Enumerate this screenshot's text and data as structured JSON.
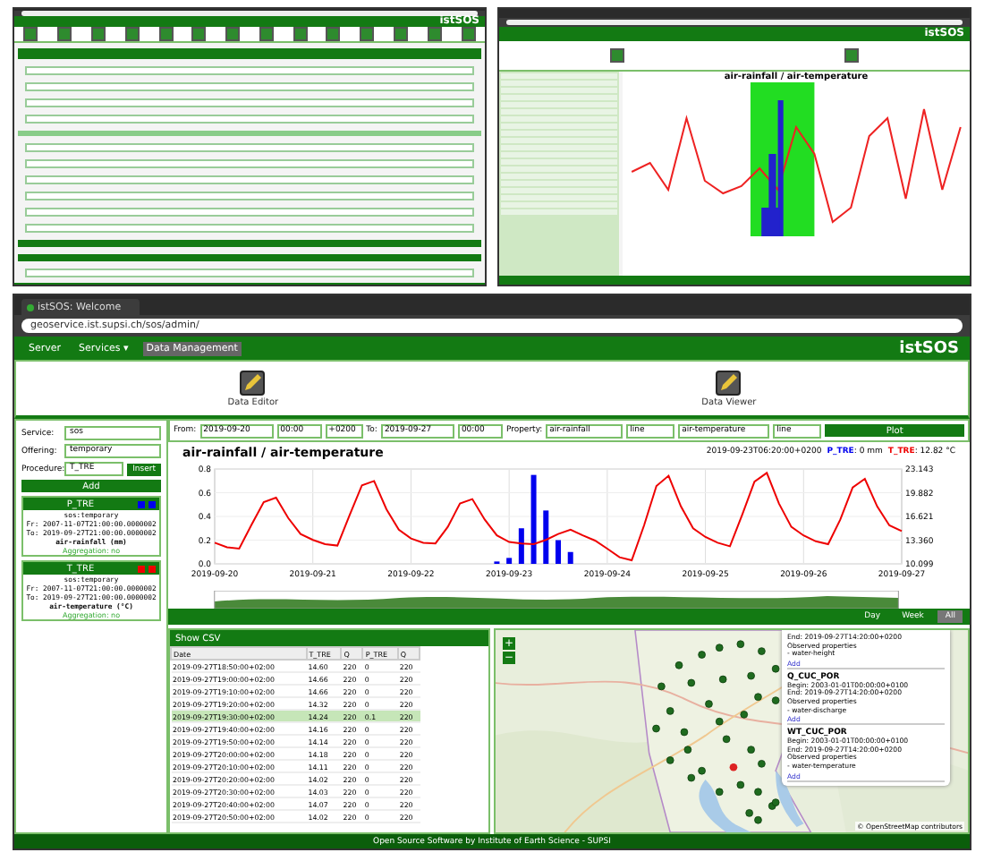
{
  "top_left_window": {
    "logo": "istSOS"
  },
  "top_right_window": {
    "logo": "istSOS",
    "chart_title": "air-rainfall / air-temperature"
  },
  "browser": {
    "tab_title": "istSOS: Welcome",
    "address": "geoservice.ist.supsi.ch/sos/admin/"
  },
  "nav": {
    "items": [
      {
        "label": "Server",
        "selected": false
      },
      {
        "label": "Services ▾",
        "selected": false
      },
      {
        "label": "Data Management",
        "selected": true
      }
    ],
    "logo": "istSOS"
  },
  "tools": [
    {
      "label": "Data Editor"
    },
    {
      "label": "Data Viewer"
    }
  ],
  "sidebar": {
    "fields": [
      {
        "label": "Service:",
        "value": "sos"
      },
      {
        "label": "Offering:",
        "value": "temporary"
      },
      {
        "label": "Procedure:",
        "value": "T_TRE"
      }
    ],
    "insert_button": "Insert",
    "add_button": "Add",
    "procedures": [
      {
        "name": "P_TRE",
        "color": "#0000ee",
        "offering": "sos:temporary",
        "from": "Fr: 2007-11-07T21:00:00.0000002",
        "to": "To: 2019-09-27T21:00:00.0000002",
        "property": "air-rainfall (mm)",
        "aggregation": "Aggregation: no"
      },
      {
        "name": "T_TRE",
        "color": "#ee0000",
        "offering": "sos:temporary",
        "from": "Fr: 2007-11-07T21:00:00.0000002",
        "to": "To: 2019-09-27T21:00:00.0000002",
        "property": "air-temperature (°C)",
        "aggregation": "Aggregation: no"
      }
    ]
  },
  "controls": {
    "from_label": "From:",
    "from_date": "2019-09-20",
    "from_time": "00:00",
    "offset": "+0200",
    "to_label": "To:",
    "to_date": "2019-09-27",
    "to_time": "00:00",
    "property_label": "Property:",
    "property_1": "air-rainfall",
    "style_1": "line",
    "property_2": "air-temperature",
    "style_2": "line",
    "plot_button": "Plot"
  },
  "chart": {
    "legend": {
      "time": "2019-09-23T06:20:00+0200",
      "readings": [
        ": 0 mm",
        ": 12.82 °C"
      ]
    },
    "chart_data": {
      "type": "line",
      "title": "air-rainfall / air-temperature",
      "grid": true,
      "ylim": [
        0,
        0.8
      ],
      "categories": [
        "2019-09-20",
        null,
        null,
        null,
        null,
        null,
        null,
        null,
        "2019-09-21",
        null,
        null,
        null,
        null,
        null,
        null,
        null,
        "2019-09-22",
        null,
        null,
        null,
        null,
        null,
        null,
        null,
        "2019-09-23",
        null,
        null,
        null,
        null,
        null,
        null,
        null,
        "2019-09-24",
        null,
        null,
        null,
        null,
        null,
        null,
        null,
        "2019-09-25",
        null,
        null,
        null,
        null,
        null,
        null,
        null,
        "2019-09-26",
        null,
        null,
        null,
        null,
        null,
        null,
        null,
        "2019-09-27"
      ],
      "yticks": [
        {
          "value": 0,
          "label": "0.0"
        },
        {
          "value": 0.2,
          "label": "0.2"
        },
        {
          "value": 0.4,
          "label": "0.4"
        },
        {
          "value": 0.6,
          "label": "0.6"
        },
        {
          "value": 0.8,
          "label": "0.8"
        }
      ],
      "y2lim": [
        10.099,
        23.143
      ],
      "y2ticks": [
        {
          "value": 10.099,
          "label": "10.099"
        },
        {
          "value": 13.36,
          "label": "13.360"
        },
        {
          "value": 16.621,
          "label": "16.621"
        },
        {
          "value": 19.882,
          "label": "19.882"
        },
        {
          "value": 23.143,
          "label": "23.143"
        }
      ],
      "series": [
        {
          "name": "P_TRE",
          "type": "bar",
          "color": "#0000ee",
          "values": [
            0,
            0,
            0,
            0,
            0,
            0,
            0,
            0,
            0,
            0,
            0,
            0,
            0,
            0,
            0,
            0,
            0,
            0,
            0,
            0,
            0,
            0,
            0,
            0.02,
            0.05,
            0.3,
            0.75,
            0.45,
            0.2,
            0.1,
            0,
            0,
            0,
            0,
            0,
            0,
            0,
            0,
            0,
            0,
            0,
            0,
            0,
            0,
            0,
            0,
            0,
            0,
            0,
            0,
            0,
            0,
            0,
            0,
            0,
            0,
            0
          ]
        },
        {
          "name": "T_TRE",
          "type": "line",
          "axis": "y2",
          "color": "#ee0000",
          "values": [
            13.0,
            12.4,
            12.2,
            15.5,
            18.6,
            19.2,
            16.4,
            14.2,
            13.4,
            12.8,
            12.6,
            16.8,
            20.9,
            21.5,
            17.6,
            14.8,
            13.6,
            13.0,
            12.9,
            15.2,
            18.4,
            19.0,
            16.2,
            14.0,
            13.1,
            12.9,
            12.8,
            13.4,
            14.2,
            14.8,
            14.0,
            13.3,
            12.2,
            11.0,
            10.6,
            15.4,
            20.8,
            22.2,
            18.0,
            15.0,
            13.8,
            13.0,
            12.5,
            16.9,
            21.4,
            22.6,
            18.4,
            15.2,
            14.0,
            13.2,
            12.8,
            16.2,
            20.6,
            21.8,
            18.0,
            15.4,
            14.6
          ]
        }
      ]
    }
  },
  "range_buttons": [
    {
      "label": "Day",
      "selected": false
    },
    {
      "label": "Week",
      "selected": false
    },
    {
      "label": "All",
      "selected": true
    }
  ],
  "table": {
    "title": "Show CSV",
    "columns": [
      "Date",
      "T_TRE",
      "Q",
      "P_TRE",
      "Q"
    ],
    "rows": [
      {
        "cells": [
          "2019-09-27T18:50:00+02:00",
          "14.60",
          "220",
          "0",
          "220"
        ],
        "selected": false
      },
      {
        "cells": [
          "2019-09-27T19:00:00+02:00",
          "14.66",
          "220",
          "0",
          "220"
        ],
        "selected": false
      },
      {
        "cells": [
          "2019-09-27T19:10:00+02:00",
          "14.66",
          "220",
          "0",
          "220"
        ],
        "selected": false
      },
      {
        "cells": [
          "2019-09-27T19:20:00+02:00",
          "14.32",
          "220",
          "0",
          "220"
        ],
        "selected": false
      },
      {
        "cells": [
          "2019-09-27T19:30:00+02:00",
          "14.24",
          "220",
          "0.1",
          "220"
        ],
        "selected": true
      },
      {
        "cells": [
          "2019-09-27T19:40:00+02:00",
          "14.16",
          "220",
          "0",
          "220"
        ],
        "selected": false
      },
      {
        "cells": [
          "2019-09-27T19:50:00+02:00",
          "14.14",
          "220",
          "0",
          "220"
        ],
        "selected": false
      },
      {
        "cells": [
          "2019-09-27T20:00:00+02:00",
          "14.18",
          "220",
          "0",
          "220"
        ],
        "selected": false
      },
      {
        "cells": [
          "2019-09-27T20:10:00+02:00",
          "14.11",
          "220",
          "0",
          "220"
        ],
        "selected": false
      },
      {
        "cells": [
          "2019-09-27T20:20:00+02:00",
          "14.02",
          "220",
          "0",
          "220"
        ],
        "selected": false
      },
      {
        "cells": [
          "2019-09-27T20:30:00+02:00",
          "14.03",
          "220",
          "0",
          "220"
        ],
        "selected": false
      },
      {
        "cells": [
          "2019-09-27T20:40:00+02:00",
          "14.07",
          "220",
          "0",
          "220"
        ],
        "selected": false
      },
      {
        "cells": [
          "2019-09-27T20:50:00+02:00",
          "14.02",
          "220",
          "0",
          "220"
        ],
        "selected": false
      }
    ]
  },
  "map": {
    "kind": "picture",
    "zoom_in": "+",
    "zoom_out": "−",
    "attribution": "© OpenStreetMap contributors",
    "popup": [
      {
        "lines": [
          "End: 2019-09-27T14:20:00+0200",
          "Observed properties",
          "- water-height"
        ],
        "link": "Add"
      },
      {
        "name": "Q_CUC_POR",
        "lines": [
          "Begin: 2003-01-01T00:00:00+0100",
          "End: 2019-09-27T14:20:00+0200",
          "Observed properties",
          "- water-discharge"
        ],
        "link": "Add"
      },
      {
        "name": "WT_CUC_POR",
        "lines": [
          "Begin: 2003-01-01T00:00:00+0100",
          "End: 2019-09-27T14:20:00+0200",
          "Observed properties",
          "- water-temperature"
        ],
        "link": "Add"
      }
    ]
  },
  "footer": "Open Source Software by Institute of Earth Science - SUPSI"
}
